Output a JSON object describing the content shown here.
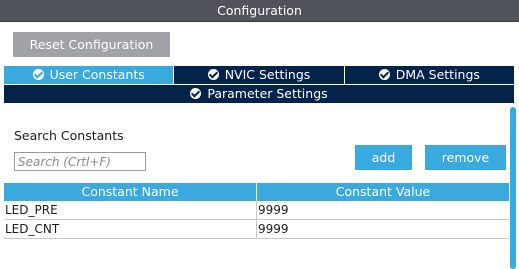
{
  "window": {
    "title": "Configuration"
  },
  "toolbar": {
    "reset_label": "Reset Configuration"
  },
  "tabs": [
    {
      "label": "User Constants",
      "active": true,
      "icon": "check-circle-icon"
    },
    {
      "label": "NVIC Settings",
      "active": false,
      "icon": "check-circle-icon"
    },
    {
      "label": "DMA Settings",
      "active": false,
      "icon": "check-circle-icon"
    },
    {
      "label": "Parameter Settings",
      "active": false,
      "icon": "check-circle-icon"
    }
  ],
  "search": {
    "label": "Search Constants",
    "placeholder": "Search (Crtl+F)",
    "value": ""
  },
  "actions": {
    "add_label": "add",
    "remove_label": "remove"
  },
  "table": {
    "columns": [
      "Constant Name",
      "Constant Value"
    ],
    "rows": [
      {
        "name": "LED_PRE",
        "value": "9999"
      },
      {
        "name": "LED_CNT",
        "value": "9999"
      }
    ]
  },
  "colors": {
    "accent": "#3aa9dd",
    "tab_dark": "#03234b",
    "title_bar": "#51535a",
    "reset_button": "#a0a2a5"
  }
}
